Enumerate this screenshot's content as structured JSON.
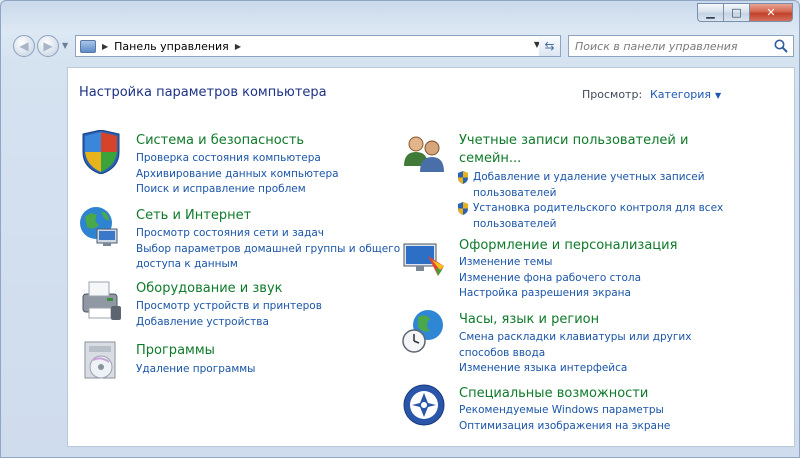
{
  "toolbar": {
    "address": "Панель управления",
    "search_placeholder": "Поиск в панели управления"
  },
  "header": {
    "title": "Настройка параметров компьютера",
    "view_label": "Просмотр:",
    "view_value": "Категория"
  },
  "categories": {
    "system": {
      "title": "Система и безопасность",
      "links": [
        "Проверка состояния компьютера",
        "Архивирование данных компьютера",
        "Поиск и исправление проблем"
      ]
    },
    "network": {
      "title": "Сеть и Интернет",
      "links": [
        "Просмотр состояния сети и задач",
        "Выбор параметров домашней группы и общего",
        "доступа к данным"
      ]
    },
    "hardware": {
      "title": "Оборудование и звук",
      "links": [
        "Просмотр устройств и принтеров",
        "Добавление устройства"
      ]
    },
    "programs": {
      "title": "Программы",
      "links": [
        "Удаление программы"
      ]
    },
    "users": {
      "title_line1": "Учетные записи пользователей и",
      "title_line2": "семейн...",
      "links": [
        "Добавление и удаление учетных записей",
        "пользователей",
        "Установка родительского контроля для всех",
        "пользователей"
      ]
    },
    "appearance": {
      "title": "Оформление и персонализация",
      "links": [
        "Изменение темы",
        "Изменение фона рабочего стола",
        "Настройка разрешения экрана"
      ]
    },
    "clock": {
      "title": "Часы, язык и регион",
      "links": [
        "Смена раскладки клавиатуры или других",
        "способов ввода",
        "Изменение языка интерфейса"
      ]
    },
    "access": {
      "title": "Специальные возможности",
      "links": [
        "Рекомендуемые Windows параметры",
        "Оптимизация изображения на экране"
      ]
    }
  }
}
